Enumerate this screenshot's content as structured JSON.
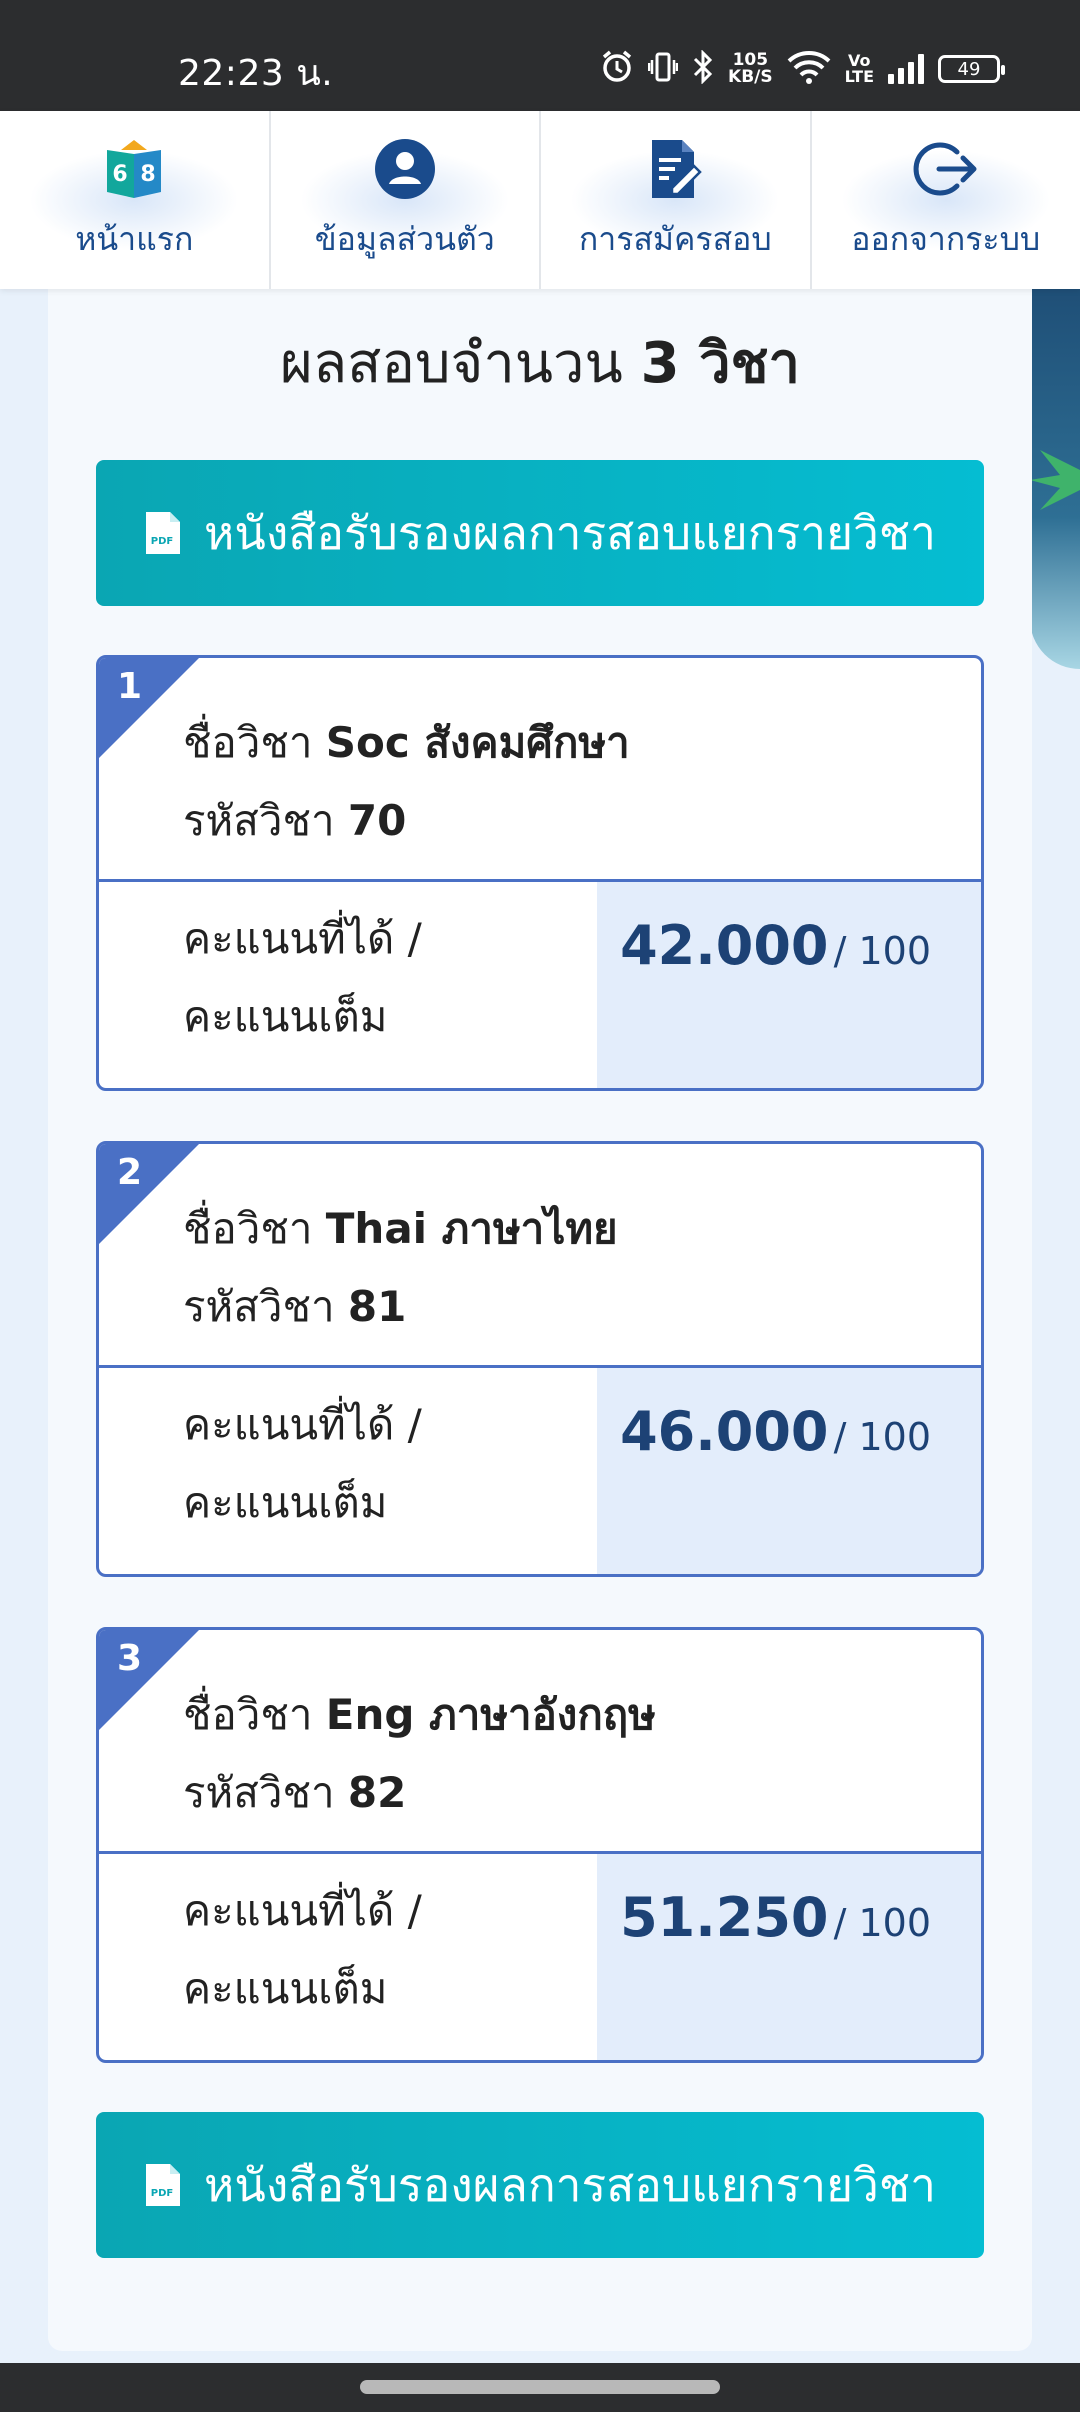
{
  "status_bar": {
    "time": "22:23 น.",
    "net_speed_value": "105",
    "net_speed_unit": "KB/S",
    "volte_top": "Vo",
    "volte_bottom": "LTE",
    "battery": "49",
    "icons": [
      "alarm-icon",
      "vibrate-icon",
      "bluetooth-icon",
      "wifi-icon",
      "signal-icon",
      "battery-icon"
    ]
  },
  "nav": {
    "items": [
      {
        "label": "หน้าแรก",
        "icon": "book-icon"
      },
      {
        "label": "ข้อมูลส่วนตัว",
        "icon": "user-icon"
      },
      {
        "label": "การสมัครสอบ",
        "icon": "form-edit-icon"
      },
      {
        "label": "ออกจากระบบ",
        "icon": "logout-icon"
      }
    ],
    "logo_digits": [
      "6",
      "8"
    ]
  },
  "results": {
    "title_prefix": "ผลสอบจำนวน",
    "title_count": "3 วิชา",
    "cert_button_label": "หนังสือรับรองผลการสอบแยกรายวิชา",
    "pdf_icon_text": "PDF",
    "subject_label": "ชื่อวิชา",
    "code_label": "รหัสวิชา",
    "score_label_line1": "คะแนนที่ได้ /",
    "score_label_line2": "คะแนนเต็ม",
    "subjects": [
      {
        "num": "1",
        "name": "Soc สังคมศึกษา",
        "code": "70",
        "score": "42.000",
        "full": "/ 100"
      },
      {
        "num": "2",
        "name": "Thai ภาษาไทย",
        "code": "81",
        "score": "46.000",
        "full": "/ 100"
      },
      {
        "num": "3",
        "name": "Eng ภาษาอังกฤษ",
        "code": "82",
        "score": "51.250",
        "full": "/ 100"
      }
    ]
  },
  "colors": {
    "accent_blue": "#4a70c5",
    "teal_button": "#0aa6b3",
    "score_text": "#1d4275",
    "score_bg": "#e3edfb"
  }
}
